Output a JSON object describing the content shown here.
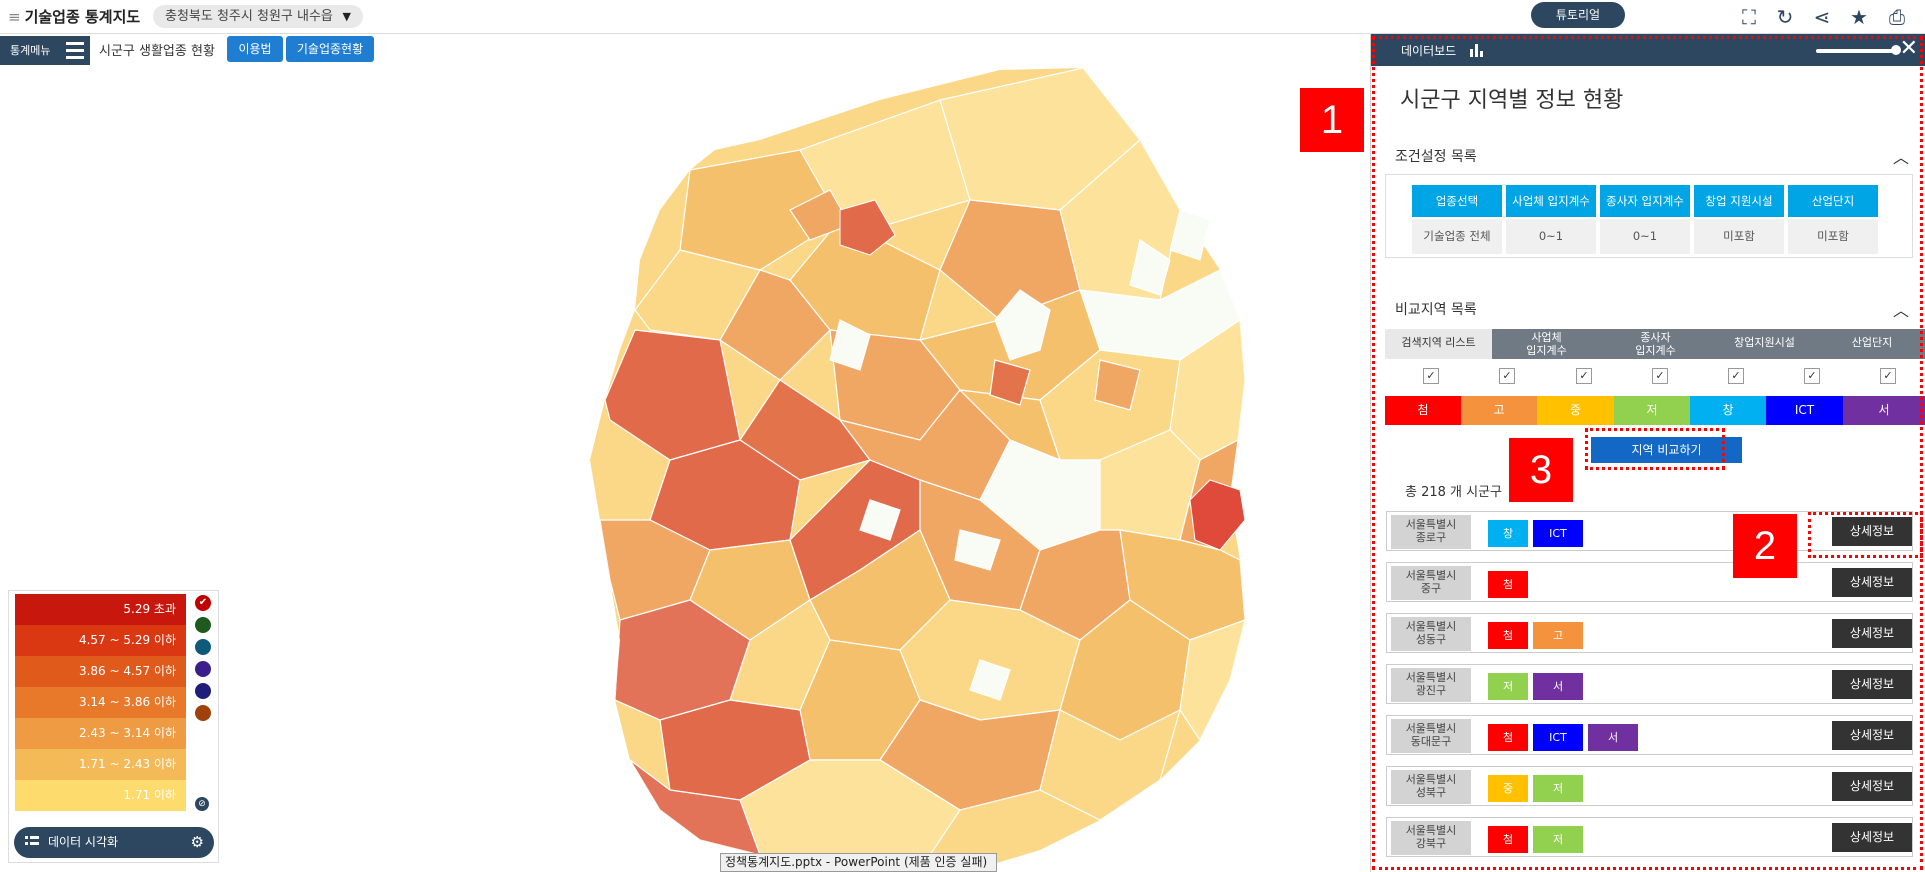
{
  "topbar": {
    "menu_glyph": "≡",
    "app_title": "기술업종 통계지도",
    "location": "충청북도 청주시 청원구 내수읍",
    "location_arrow": "▼",
    "tutorial": "튜토리얼",
    "icons": [
      "fullscreen-icon",
      "refresh-icon",
      "share-icon",
      "star-icon",
      "print-icon"
    ]
  },
  "secbar": {
    "stat_menu": "통계메뉴",
    "title": "시군구 생활업종 현황",
    "howto": "이용법",
    "tech_status": "기술업종현황"
  },
  "legend": {
    "rows": [
      {
        "label": "5.29 초과",
        "color": "#c8180d"
      },
      {
        "label": "4.57 ~ 5.29 이하",
        "color": "#d93812"
      },
      {
        "label": "3.86 ~ 4.57 이하",
        "color": "#e05a1c"
      },
      {
        "label": "3.14 ~ 3.86 이하",
        "color": "#e8792b"
      },
      {
        "label": "2.43 ~ 3.14 이하",
        "color": "#ef9b44"
      },
      {
        "label": "1.71 ~ 2.43 이하",
        "color": "#f5ba58"
      },
      {
        "label": "1.71 이하",
        "color": "#fddb6d"
      }
    ],
    "swatches": [
      "#c00000",
      "#1e5a1e",
      "#0f5a7a",
      "#3c1e8a",
      "#1e1e7a",
      "#a0400a"
    ],
    "data_vis": "데이터 시각화"
  },
  "taskbar": "정책통계지도.pptx - PowerPoint (제품 인증 실패)",
  "panel": {
    "header": "데이터보드",
    "title": "시군구 지역별 정보 현황",
    "cond_title": "조건설정 목록",
    "cond_heads": [
      "업종선택",
      "사업체 입지계수",
      "종사자 입지계수",
      "창업 지원시설",
      "산업단지"
    ],
    "cond_vals": [
      "기술업종 전체",
      "0~1",
      "0~1",
      "미포함",
      "미포함"
    ],
    "compare_title": "비교지역 목록",
    "tabs": [
      "검색지역 리스트",
      "사업체\n입지계수",
      "종사자\n입지계수",
      "창업지원시설",
      "산업단지"
    ],
    "categories": [
      {
        "label": "첨",
        "color": "#ff0000"
      },
      {
        "label": "고",
        "color": "#f5923e"
      },
      {
        "label": "중",
        "color": "#ffc000"
      },
      {
        "label": "저",
        "color": "#92d050"
      },
      {
        "label": "창",
        "color": "#00b0f0"
      },
      {
        "label": "ICT",
        "color": "#0000ff"
      },
      {
        "label": "서",
        "color": "#7030a0"
      }
    ],
    "compare_btn": "지역 비교하기",
    "total": "총 218 개 시군구",
    "detail_label": "상세정보",
    "rows": [
      {
        "name": "서울특별시\n종로구",
        "tags": [
          "창",
          "ICT"
        ]
      },
      {
        "name": "서울특별시\n중구",
        "tags": [
          "첨"
        ]
      },
      {
        "name": "서울특별시\n성동구",
        "tags": [
          "첨",
          "고"
        ]
      },
      {
        "name": "서울특별시\n광진구",
        "tags": [
          "저",
          "서"
        ]
      },
      {
        "name": "서울특별시\n동대문구",
        "tags": [
          "첨",
          "ICT",
          "서"
        ]
      },
      {
        "name": "서울특별시\n성북구",
        "tags": [
          "중",
          "저"
        ]
      },
      {
        "name": "서울특별시\n강북구",
        "tags": [
          "첨",
          "저"
        ]
      }
    ]
  },
  "annotations": [
    "1",
    "2",
    "3"
  ]
}
